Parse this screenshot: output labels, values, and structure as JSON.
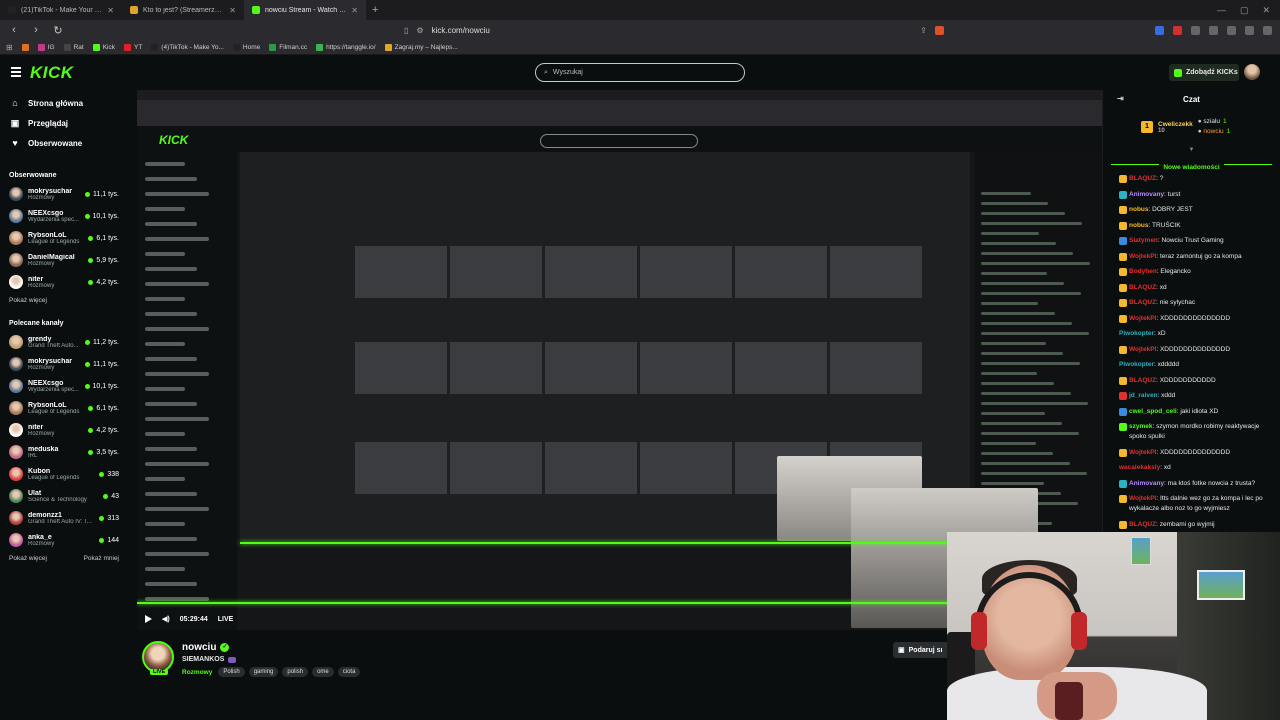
{
  "browser": {
    "tabs": [
      {
        "label": "(21)TikTok - Make Your Day",
        "active": false,
        "color": "#222"
      },
      {
        "label": "Kto to jest? (Streamerzy) - Zagraj.my",
        "active": false,
        "color": "#e0a52a"
      },
      {
        "label": "nowciu Stream - Watch Live on Kick",
        "active": true,
        "color": "#53fc18"
      }
    ],
    "url": "kick.com/nowciu",
    "bookmarks": [
      {
        "label": "IG",
        "color": "#c43a8a"
      },
      {
        "label": "Rat",
        "color": "#444"
      },
      {
        "label": "Kick",
        "color": "#53fc18"
      },
      {
        "label": "YT",
        "color": "#e02020"
      },
      {
        "label": "(4)TikTok - Make Yo...",
        "color": "#222"
      },
      {
        "label": "Home",
        "color": "#222"
      },
      {
        "label": "Filman.cc",
        "color": "#2a9a4a"
      },
      {
        "label": "https://tanggle.io/",
        "color": "#3cb44a"
      },
      {
        "label": "Zagraj.my – Najleps...",
        "color": "#e0a52a"
      }
    ]
  },
  "kick": {
    "logo": "KICK",
    "search_placeholder": "Wyszukaj",
    "kicks_button": "Zdobądź KICKs"
  },
  "sidebar": {
    "nav": [
      {
        "label": "Strona główna",
        "icon": "home-icon",
        "glyph": "⌂"
      },
      {
        "label": "Przeglądaj",
        "icon": "browse-icon",
        "glyph": "▣"
      },
      {
        "label": "Obserwowane",
        "icon": "heart-icon",
        "glyph": "♥"
      }
    ],
    "followed_title": "Obserwowane",
    "followed": [
      {
        "name": "mokrysuchar",
        "category": "Rozmowy",
        "viewers": "11,1 tys.",
        "color": "#3b4a5a"
      },
      {
        "name": "NEEXcsgo",
        "category": "Wydarzenia spec...",
        "viewers": "10,1 tys.",
        "color": "#5a7a9a"
      },
      {
        "name": "RybsonLoL",
        "category": "League of Legends",
        "viewers": "6,1 tys.",
        "color": "#a67a5a"
      },
      {
        "name": "DanielMagical",
        "category": "Rozmowy",
        "viewers": "5,9 tys.",
        "color": "#8a6a5a"
      },
      {
        "name": "niter",
        "category": "Rozmowy",
        "viewers": "4,2 tys.",
        "color": "#ffffff"
      }
    ],
    "followed_more": "Pokaż więcej",
    "recommended_title": "Polecane kanały",
    "recommended": [
      {
        "name": "grendy",
        "category": "Grand Theft Auto...",
        "viewers": "11,2 tys.",
        "color": "#c0a070"
      },
      {
        "name": "mokrysuchar",
        "category": "Rozmowy",
        "viewers": "11,1 tys.",
        "color": "#3b4a5a"
      },
      {
        "name": "NEEXcsgo",
        "category": "Wydarzenia spec...",
        "viewers": "10,1 tys.",
        "color": "#5a7a9a"
      },
      {
        "name": "RybsonLoL",
        "category": "League of Legends",
        "viewers": "6,1 tys.",
        "color": "#a67a5a"
      },
      {
        "name": "niter",
        "category": "Rozmowy",
        "viewers": "4,2 tys.",
        "color": "#ffffff"
      },
      {
        "name": "meduska",
        "category": "IRL",
        "viewers": "3,5 tys.",
        "color": "#c06a8a"
      },
      {
        "name": "Kubon",
        "category": "League of Legends",
        "viewers": "338",
        "color": "#e04040"
      },
      {
        "name": "Ulat",
        "category": "Science & Technology",
        "viewers": "43",
        "color": "#4a8a5a"
      },
      {
        "name": "demonzz1",
        "category": "Grand Theft Auto IV: T...",
        "viewers": "313",
        "color": "#b04040"
      },
      {
        "name": "anka_e",
        "category": "Rozmowy",
        "viewers": "144",
        "color": "#c05aa0"
      }
    ],
    "show_more": "Pokaż więcej",
    "show_less": "Pokaż mniej"
  },
  "player": {
    "time": "05:29:44",
    "live": "LIVE"
  },
  "streamer": {
    "name": "nowciu",
    "live_badge": "LIVE",
    "title": "SIEMANKOS",
    "category": "Rozmowy",
    "tags": [
      "Polish",
      "gaming",
      "polish",
      "ome",
      "ciota"
    ],
    "subscribe_button": "Podaruj sı"
  },
  "chat": {
    "title": "Czat",
    "pinned": {
      "top_name": "Cweliczekk",
      "top_count": "10",
      "right": [
        {
          "name": "szialu",
          "count": "1"
        },
        {
          "name": "nowciu",
          "count": "1"
        }
      ]
    },
    "divider": "Nowe wiadomości",
    "messages": [
      {
        "user": "BLAQUZ",
        "text": ": ?",
        "color": "#e03030",
        "badge": "#f5b82e"
      },
      {
        "user": "Animovany",
        "text": ": turst",
        "color": "#b48cff",
        "badge": "#2ab3c0"
      },
      {
        "user": "nobus",
        "text": ": DOBRY JEST",
        "color": "#f5b82e",
        "badge": "#f5b82e"
      },
      {
        "user": "nobus",
        "text": ": TRUŚCIK",
        "color": "#f5b82e",
        "badge": "#f5b82e"
      },
      {
        "user": "Siatymen",
        "text": ": Nowciu Trust Gaming",
        "color": "#e03030",
        "badge": "#3a8ae0"
      },
      {
        "user": "WojtekPl",
        "text": ": teraz zamontuj go za kompa",
        "color": "#e03030",
        "badge": "#f5b82e"
      },
      {
        "user": "Bodyhen",
        "text": ": Elegancko",
        "color": "#e03030",
        "badge": "#f5b82e"
      },
      {
        "user": "BLAQUZ",
        "text": ": xd",
        "color": "#e03030",
        "badge": "#f5b82e"
      },
      {
        "user": "BLAQUZ",
        "text": ": nie sylychac",
        "color": "#e03030",
        "badge": "#f5b82e"
      },
      {
        "user": "WojtekPl",
        "text": ": XDDDDDDDDDDDDDD",
        "color": "#e03030",
        "badge": "#f5b82e"
      },
      {
        "user": "Piwokopter",
        "text": ": xD",
        "color": "#2ab3c0",
        "badge": ""
      },
      {
        "user": "WojtekPl",
        "text": ": XDDDDDDDDDDDDDD",
        "color": "#e03030",
        "badge": "#f5b82e"
      },
      {
        "user": "Piwokopter",
        "text": ": xddddd",
        "color": "#2ab3c0",
        "badge": ""
      },
      {
        "user": "BLAQUZ",
        "text": ": XDDDDDDDDDDD",
        "color": "#e03030",
        "badge": "#f5b82e"
      },
      {
        "user": "jd_raiven",
        "text": ": xddd",
        "color": "#2ab3c0",
        "badge": "#e03030"
      },
      {
        "user": "cwel_spod_celi",
        "text": ": jaki idiota XD",
        "color": "#53fc18",
        "badge": "#3a8ae0"
      },
      {
        "user": "szymek",
        "text": ": szymon mordko robimy reaktywacje spoko spulki",
        "color": "#53fc18",
        "badge": "#53fc18"
      },
      {
        "user": "WojtekPl",
        "text": ": XDDDDDDDDDDDDDD",
        "color": "#e03030",
        "badge": "#f5b82e"
      },
      {
        "user": "wacalekaksly",
        "text": ": xd",
        "color": "#e03030",
        "badge": ""
      },
      {
        "user": "Animovany",
        "text": ": ma ktoś fotke nowcia z trusta?",
        "color": "#b48cff",
        "badge": "#2ab3c0"
      },
      {
        "user": "WojtekPl",
        "text": ": Itts dalnie wez go za kompa i lec po wykalacze albo noz to go wyjmiesz",
        "color": "#e03030",
        "badge": "#f5b82e"
      },
      {
        "user": "BLAQUZ",
        "text": ": zembami go wyjmij",
        "color": "#e03030",
        "badge": "#f5b82e"
      }
    ]
  }
}
